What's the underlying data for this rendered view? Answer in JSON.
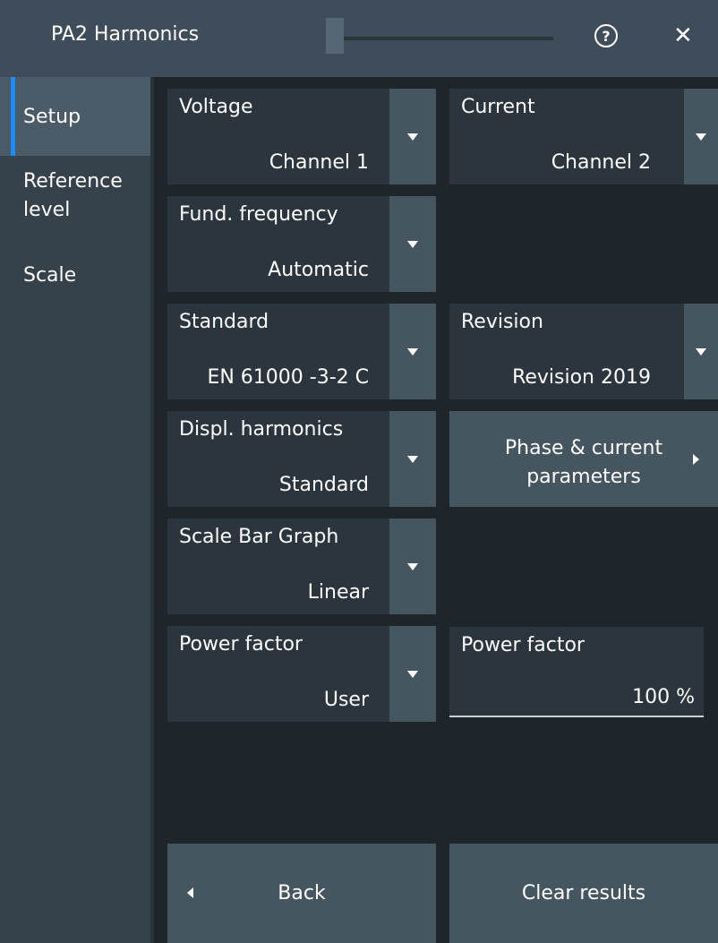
{
  "window": {
    "title": "PA2 Harmonics"
  },
  "icons": {
    "help": "question-circle-icon",
    "close": "close-icon",
    "dropdown": "triangle-down-icon"
  },
  "sidebar": {
    "items": [
      {
        "label": "Setup",
        "active": true
      },
      {
        "label": "Reference level",
        "active": false
      },
      {
        "label": "Scale",
        "active": false
      }
    ]
  },
  "fields": {
    "voltage": {
      "label": "Voltage",
      "value": "Channel 1"
    },
    "current": {
      "label": "Current",
      "value": "Channel 2"
    },
    "fund_frequency": {
      "label": "Fund. frequency",
      "value": "Automatic"
    },
    "standard": {
      "label": "Standard",
      "value": "EN 61000 -3-2 C"
    },
    "revision": {
      "label": "Revision",
      "value": "Revision 2019"
    },
    "displ_harmonics": {
      "label": "Displ. harmonics",
      "value": "Standard"
    },
    "scale_bar_graph": {
      "label": "Scale Bar Graph",
      "value": "Linear"
    },
    "power_factor_mode": {
      "label": "Power factor",
      "value": "User"
    },
    "power_factor_value": {
      "label": "Power factor",
      "value": "100 %"
    }
  },
  "buttons": {
    "phase_current": {
      "line1": "Phase & current",
      "line2": "parameters"
    },
    "back": "Back",
    "clear_results": "Clear results"
  },
  "colors": {
    "accent": "#1a8cff",
    "titlebar": "#3e4d59",
    "button": "#455661"
  }
}
